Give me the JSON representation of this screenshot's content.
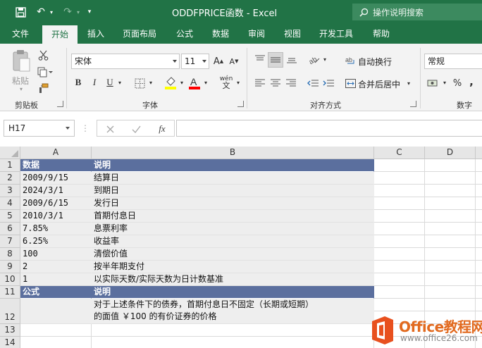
{
  "window": {
    "title": "ODDFPRICE函数  -  Excel",
    "tell_me": "操作说明搜索"
  },
  "qat": {
    "undo_label": "↶",
    "redo_label": "↷"
  },
  "ribbon_tabs": [
    "文件",
    "开始",
    "插入",
    "页面布局",
    "公式",
    "数据",
    "审阅",
    "视图",
    "开发工具",
    "帮助"
  ],
  "active_tab": "开始",
  "ribbon": {
    "clipboard": {
      "label": "剪贴板",
      "paste": "粘贴"
    },
    "font": {
      "label": "字体",
      "font_name": "宋体",
      "font_size": "11",
      "bold": "B",
      "italic": "I",
      "underline": "U",
      "wen": "wén",
      "font_color": "#ff0000",
      "fill_color": "#ffff00"
    },
    "alignment": {
      "label": "对齐方式",
      "wrap_text": "自动换行",
      "merge_center": "合并后居中"
    },
    "number": {
      "label": "数字",
      "format": "常规",
      "percent": "%",
      "comma": ","
    }
  },
  "formula_bar": {
    "name_box": "H17",
    "fx": "fx",
    "value": ""
  },
  "columns": [
    "A",
    "B",
    "C",
    "D"
  ],
  "rows": [
    {
      "num": "1",
      "a": "数据",
      "b": "说明",
      "style": "header"
    },
    {
      "num": "2",
      "a": "2009/9/15",
      "b": "结算日",
      "style": "shade"
    },
    {
      "num": "3",
      "a": "2024/3/1",
      "b": "到期日",
      "style": "shade"
    },
    {
      "num": "4",
      "a": "2009/6/15",
      "b": "发行日",
      "style": "shade"
    },
    {
      "num": "5",
      "a": "2010/3/1",
      "b": "首期付息日",
      "style": "shade"
    },
    {
      "num": "6",
      "a": "7.85%",
      "b": "息票利率",
      "style": "shade"
    },
    {
      "num": "7",
      "a": "6.25%",
      "b": "收益率",
      "style": "shade"
    },
    {
      "num": "8",
      "a": "100",
      "b": "清偿价值",
      "style": "shade"
    },
    {
      "num": "9",
      "a": "2",
      "b": "按半年期支付",
      "style": "shade"
    },
    {
      "num": "10",
      "a": "1",
      "b": "以实际天数/实际天数为日计数基准",
      "style": "shade"
    },
    {
      "num": "11",
      "a": "公式",
      "b": "说明",
      "style": "header"
    },
    {
      "num": "12",
      "a": "",
      "b": "对于上述条件下的债券，首期付息日不固定（长期或短期）",
      "b2": "的面值 ￥100 的有价证券的价格",
      "style": "shade"
    },
    {
      "num": "13",
      "a": "",
      "b": "",
      "style": "plain"
    },
    {
      "num": "14",
      "a": "",
      "b": "",
      "style": "plain"
    }
  ],
  "watermark": {
    "brand": "Office教程网",
    "url": "www.office26.com"
  },
  "colors": {
    "excel_green": "#217346",
    "header_fill": "#5b6f9e",
    "shade_fill": "#eeeeee",
    "watermark_orange": "#e26a1f"
  }
}
